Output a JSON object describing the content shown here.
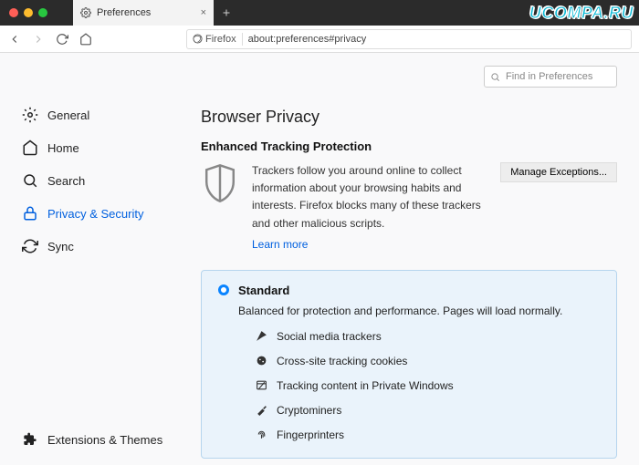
{
  "watermark": "UCOMPA.RU",
  "titlebar": {
    "tab_label": "Preferences"
  },
  "urlbar": {
    "identity": "Firefox",
    "url": "about:preferences#privacy"
  },
  "find": {
    "placeholder": "Find in Preferences"
  },
  "sidebar": {
    "items": [
      {
        "label": "General"
      },
      {
        "label": "Home"
      },
      {
        "label": "Search"
      },
      {
        "label": "Privacy & Security"
      },
      {
        "label": "Sync"
      }
    ],
    "bottom": {
      "label": "Extensions & Themes"
    }
  },
  "main": {
    "heading": "Browser Privacy",
    "etp": {
      "title": "Enhanced Tracking Protection",
      "desc": "Trackers follow you around online to collect information about your browsing habits and interests. Firefox blocks many of these trackers and other malicious scripts.",
      "learn": "Learn more",
      "manage": "Manage Exceptions..."
    },
    "standard": {
      "title": "Standard",
      "desc": "Balanced for protection and performance. Pages will load normally.",
      "items": [
        "Social media trackers",
        "Cross-site tracking cookies",
        "Tracking content in Private Windows",
        "Cryptominers",
        "Fingerprinters"
      ]
    }
  }
}
